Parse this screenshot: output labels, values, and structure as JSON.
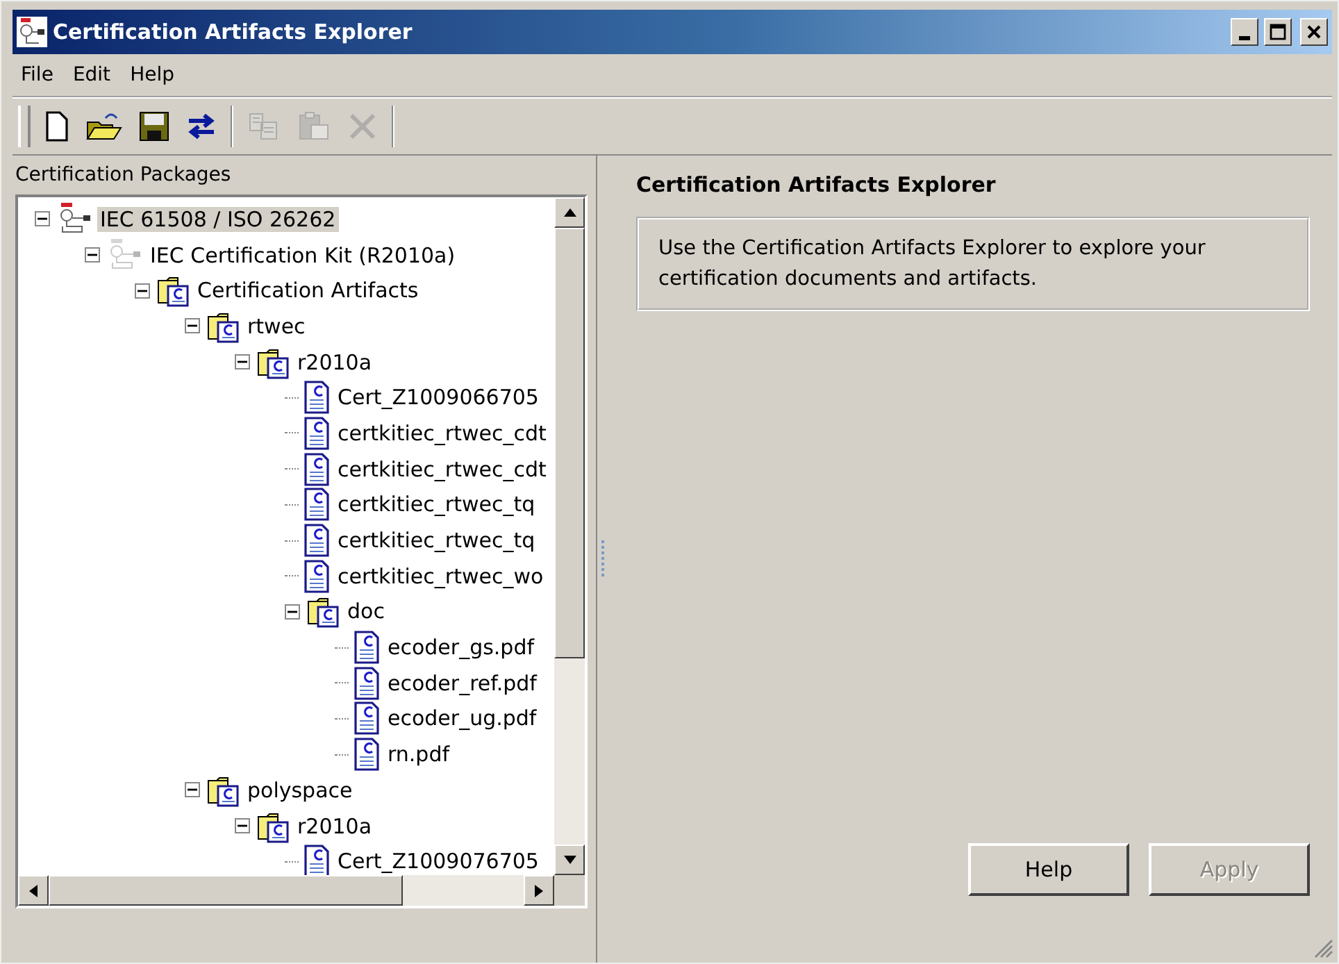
{
  "window": {
    "title": "Certification Artifacts Explorer"
  },
  "menu": [
    "File",
    "Edit",
    "Help"
  ],
  "toolbar": [
    {
      "kind": "new",
      "disabled": false
    },
    {
      "kind": "open",
      "disabled": false
    },
    {
      "kind": "save",
      "disabled": false
    },
    {
      "kind": "swap",
      "disabled": false
    },
    {
      "kind": "separator"
    },
    {
      "kind": "copy",
      "disabled": true
    },
    {
      "kind": "paste",
      "disabled": true
    },
    {
      "kind": "delete",
      "disabled": true
    },
    {
      "kind": "separator"
    }
  ],
  "left_panel": {
    "title": "Certification Packages",
    "tree": [
      {
        "label": "IEC 61508 / ISO 26262",
        "kind": "standard",
        "expanded": true,
        "selected": true,
        "children": [
          {
            "label": "IEC Certification Kit (R2010a)",
            "kind": "kit",
            "expanded": true,
            "selected": false,
            "children": [
              {
                "label": "Certification Artifacts",
                "kind": "folder",
                "expanded": true,
                "selected": false,
                "children": [
                  {
                    "label": "rtwec",
                    "kind": "folder",
                    "expanded": true,
                    "selected": false,
                    "children": [
                      {
                        "label": "r2010a",
                        "kind": "folder",
                        "expanded": true,
                        "selected": false,
                        "children": [
                          {
                            "label": "Cert_Z1009066705",
                            "kind": "file",
                            "selected": false
                          },
                          {
                            "label": "certkitiec_rtwec_cdt",
                            "kind": "file",
                            "selected": false
                          },
                          {
                            "label": "certkitiec_rtwec_cdt",
                            "kind": "file",
                            "selected": false
                          },
                          {
                            "label": "certkitiec_rtwec_tq",
                            "kind": "file",
                            "selected": false
                          },
                          {
                            "label": "certkitiec_rtwec_tq",
                            "kind": "file",
                            "selected": false
                          },
                          {
                            "label": "certkitiec_rtwec_wo",
                            "kind": "file",
                            "selected": false
                          },
                          {
                            "label": "doc",
                            "kind": "folder",
                            "expanded": true,
                            "selected": false,
                            "children": [
                              {
                                "label": "ecoder_gs.pdf",
                                "kind": "file",
                                "selected": false
                              },
                              {
                                "label": "ecoder_ref.pdf",
                                "kind": "file",
                                "selected": false
                              },
                              {
                                "label": "ecoder_ug.pdf",
                                "kind": "file",
                                "selected": false
                              },
                              {
                                "label": "rn.pdf",
                                "kind": "file",
                                "selected": false
                              }
                            ]
                          }
                        ]
                      }
                    ]
                  },
                  {
                    "label": "polyspace",
                    "kind": "folder",
                    "expanded": true,
                    "selected": false,
                    "children": [
                      {
                        "label": "r2010a",
                        "kind": "folder",
                        "expanded": true,
                        "selected": false,
                        "children": [
                          {
                            "label": "Cert_Z1009076705",
                            "kind": "file",
                            "selected": false
                          }
                        ]
                      }
                    ]
                  }
                ]
              }
            ]
          }
        ]
      }
    ]
  },
  "right_panel": {
    "title": "Certification Artifacts Explorer",
    "description": "Use the Certification Artifacts Explorer to explore your certification documents and artifacts."
  },
  "buttons": [
    {
      "label": "Help",
      "disabled": false
    },
    {
      "label": "Apply",
      "disabled": true
    }
  ]
}
